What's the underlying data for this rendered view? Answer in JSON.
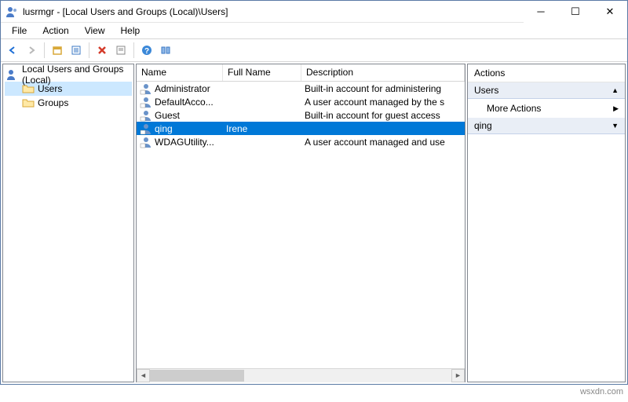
{
  "window": {
    "title": "lusrmgr - [Local Users and Groups (Local)\\Users]"
  },
  "menu": {
    "file": "File",
    "action": "Action",
    "view": "View",
    "help": "Help"
  },
  "tree": {
    "root": "Local Users and Groups (Local)",
    "users": "Users",
    "groups": "Groups"
  },
  "list": {
    "headers": {
      "name": "Name",
      "full": "Full Name",
      "desc": "Description"
    },
    "rows": [
      {
        "name": "Administrator",
        "full": "",
        "desc": "Built-in account for administering"
      },
      {
        "name": "DefaultAcco...",
        "full": "",
        "desc": "A user account managed by the s"
      },
      {
        "name": "Guest",
        "full": "",
        "desc": "Built-in account for guest access"
      },
      {
        "name": "qing",
        "full": "Irene",
        "desc": "",
        "selected": true
      },
      {
        "name": "WDAGUtility...",
        "full": "",
        "desc": "A user account managed and use"
      }
    ]
  },
  "actions": {
    "title": "Actions",
    "group1": "Users",
    "more": "More Actions",
    "group2": "qing"
  },
  "watermark": "wsxdn.com"
}
